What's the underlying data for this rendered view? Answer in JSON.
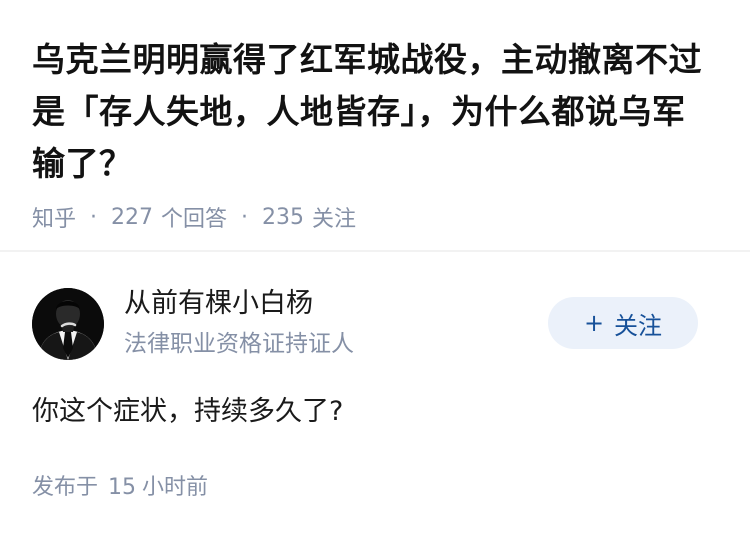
{
  "question": {
    "title": "乌克兰明明赢得了红军城战役，主动撤离不过是「存人失地，人地皆存」，为什么都说乌军输了？",
    "source": "知乎",
    "separator": "·",
    "answer_count": "227",
    "answer_label": "个回答",
    "follow_count": "235",
    "follow_label": "关注"
  },
  "answer": {
    "author": {
      "name": "从前有棵小白杨",
      "badge": "法律职业资格证持证人",
      "avatar_icon": "avatar-suit-person"
    },
    "follow_button": {
      "plus": "+",
      "label": "关注"
    },
    "content": "你这个症状，持续多久了?",
    "time": {
      "prefix": "发布于",
      "value": "15",
      "unit": "小时前"
    }
  },
  "colors": {
    "title": "#121212",
    "meta": "#8590a6",
    "follow_bg": "#ebf1fa",
    "follow_text": "#175199"
  }
}
